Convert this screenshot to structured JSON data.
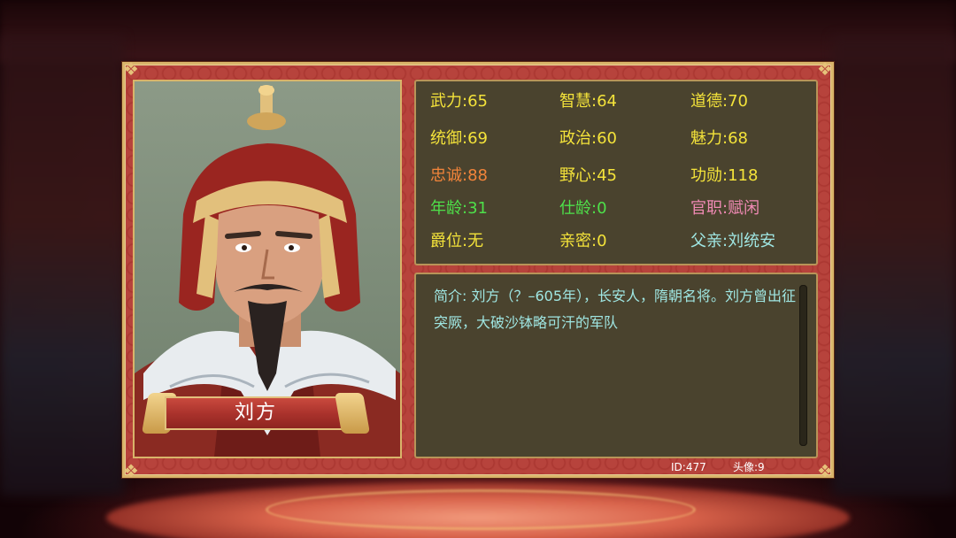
{
  "character": {
    "name": "刘方"
  },
  "stats": {
    "wuli": "武力:65",
    "zhihui": "智慧:64",
    "daode": "道德:70",
    "tongyu": "统御:69",
    "zhengzhi": "政治:60",
    "meili": "魅力:68",
    "zhongcheng": "忠诚:88",
    "yexin": "野心:45",
    "gongxun": "功勋:118",
    "nianling": "年龄:31",
    "shiling": "仕龄:0",
    "guanzhi": "官职:赋闲",
    "jueWei": "爵位:无",
    "qinmi": "亲密:0",
    "fuqin": "父亲:刘统安"
  },
  "bio": {
    "text": "简介: 刘方（？–605年），长安人，隋朝名将。刘方曾出征突厥，大破沙钵略可汗的军队"
  },
  "footer": {
    "id": "ID:477",
    "avatar": "头像:9"
  },
  "colors": {
    "default_stat": "#f4e33a",
    "loyalty": "#f2843a",
    "age": "#4ee04a",
    "office": "#f08ab4",
    "relation": "#9fe6e2",
    "bio": "#9fe6e2",
    "panel_bg": "#b23c36",
    "box_bg": "#4a432e",
    "gold_border": "#d9b46a"
  },
  "icons": {
    "corner": "ornament-corner-icon",
    "portrait": "general-portrait"
  }
}
